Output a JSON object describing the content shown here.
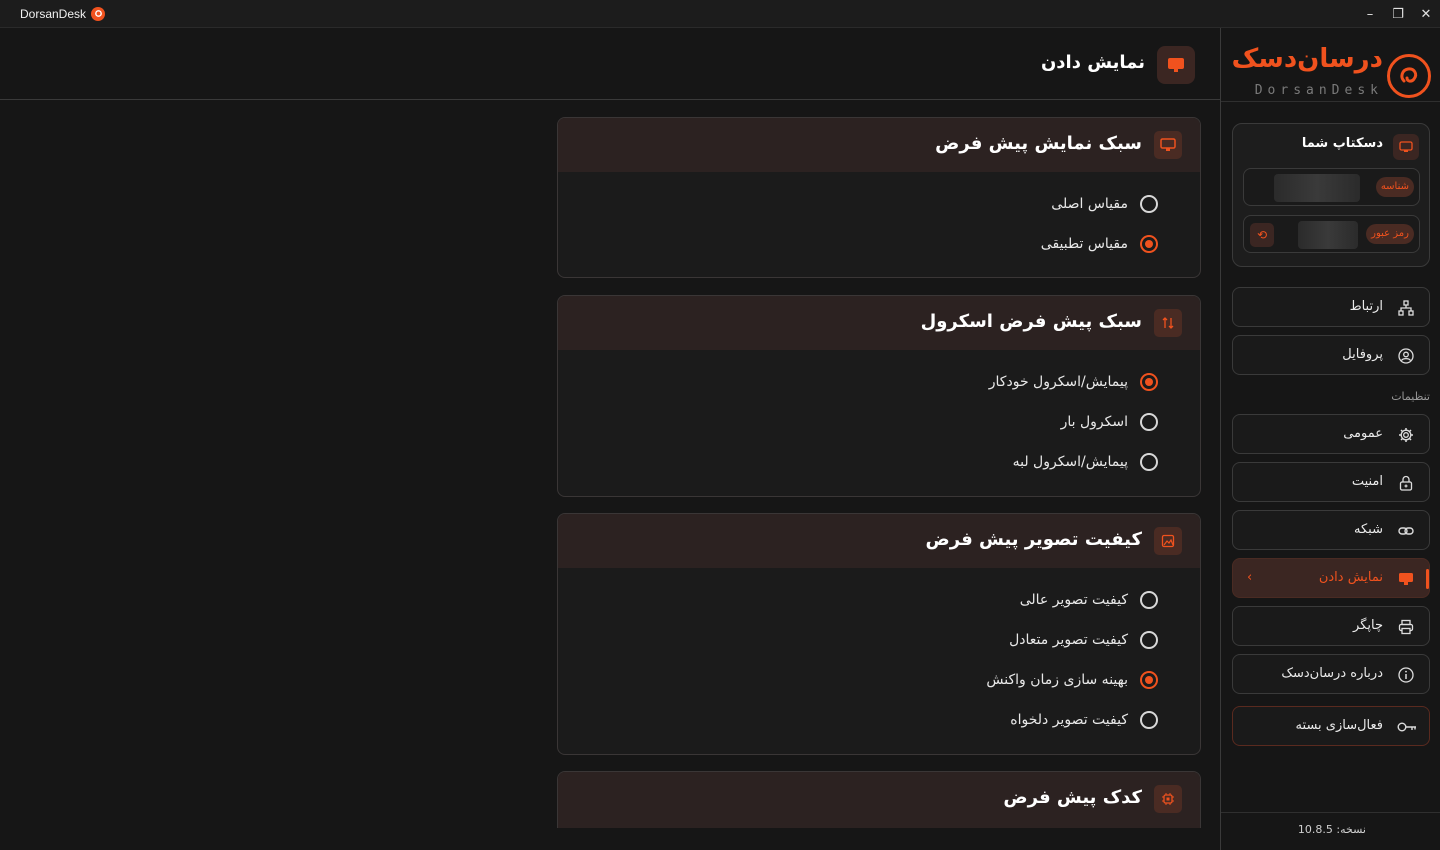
{
  "app": {
    "title": "DorsanDesk"
  },
  "window": {
    "minimize": "–",
    "maximize": "❐",
    "close": "✕"
  },
  "header": {
    "title": "نمایش دادن"
  },
  "cards": [
    {
      "title": "سبک نمایش پیش فرض",
      "options": [
        {
          "label": "مقیاس اصلی",
          "selected": false
        },
        {
          "label": "مقیاس تطبیقی",
          "selected": true
        }
      ]
    },
    {
      "title": "سبک پیش فرض اسکرول",
      "options": [
        {
          "label": "پیمایش/اسکرول خودکار",
          "selected": true
        },
        {
          "label": "اسکرول بار",
          "selected": false
        },
        {
          "label": "پیمایش/اسکرول لبه",
          "selected": false
        }
      ]
    },
    {
      "title": "کیفیت تصویر پیش فرض",
      "options": [
        {
          "label": "کیفیت تصویر عالی",
          "selected": false
        },
        {
          "label": "کیفیت تصویر متعادل",
          "selected": false
        },
        {
          "label": "بهینه سازی زمان واکنش",
          "selected": true
        },
        {
          "label": "کیفیت تصویر دلخواه",
          "selected": false
        }
      ]
    },
    {
      "title": "کدک پیش فرض",
      "options": []
    }
  ],
  "sidebar": {
    "brand_fa": "درسان‌دسک",
    "brand_en": "DorsanDesk",
    "desktop": {
      "title": "دسکتاپ شما",
      "id_tag": "شناسه",
      "password_tag": "رمز عبور"
    },
    "nav": [
      {
        "label": "ارتباط",
        "icon": "network-icon"
      },
      {
        "label": "پروفایل",
        "icon": "profile-icon"
      }
    ],
    "settings_label": "تنظیمات",
    "settings": [
      {
        "label": "عمومی",
        "icon": "gear-icon"
      },
      {
        "label": "امنیت",
        "icon": "lock-icon"
      },
      {
        "label": "شبکه",
        "icon": "link-icon"
      },
      {
        "label": "نمایش دادن",
        "icon": "monitor-icon",
        "active": true
      },
      {
        "label": "چاپگر",
        "icon": "printer-icon"
      },
      {
        "label": "درباره درسان‌دسک",
        "icon": "info-icon"
      }
    ],
    "activate": {
      "label": "فعال‌سازی بسته",
      "icon": "key-icon"
    },
    "version": "نسخه: 10.8.5"
  },
  "colors": {
    "accent": "#f0521e",
    "bg": "#161616",
    "card_head": "#2c2221"
  }
}
